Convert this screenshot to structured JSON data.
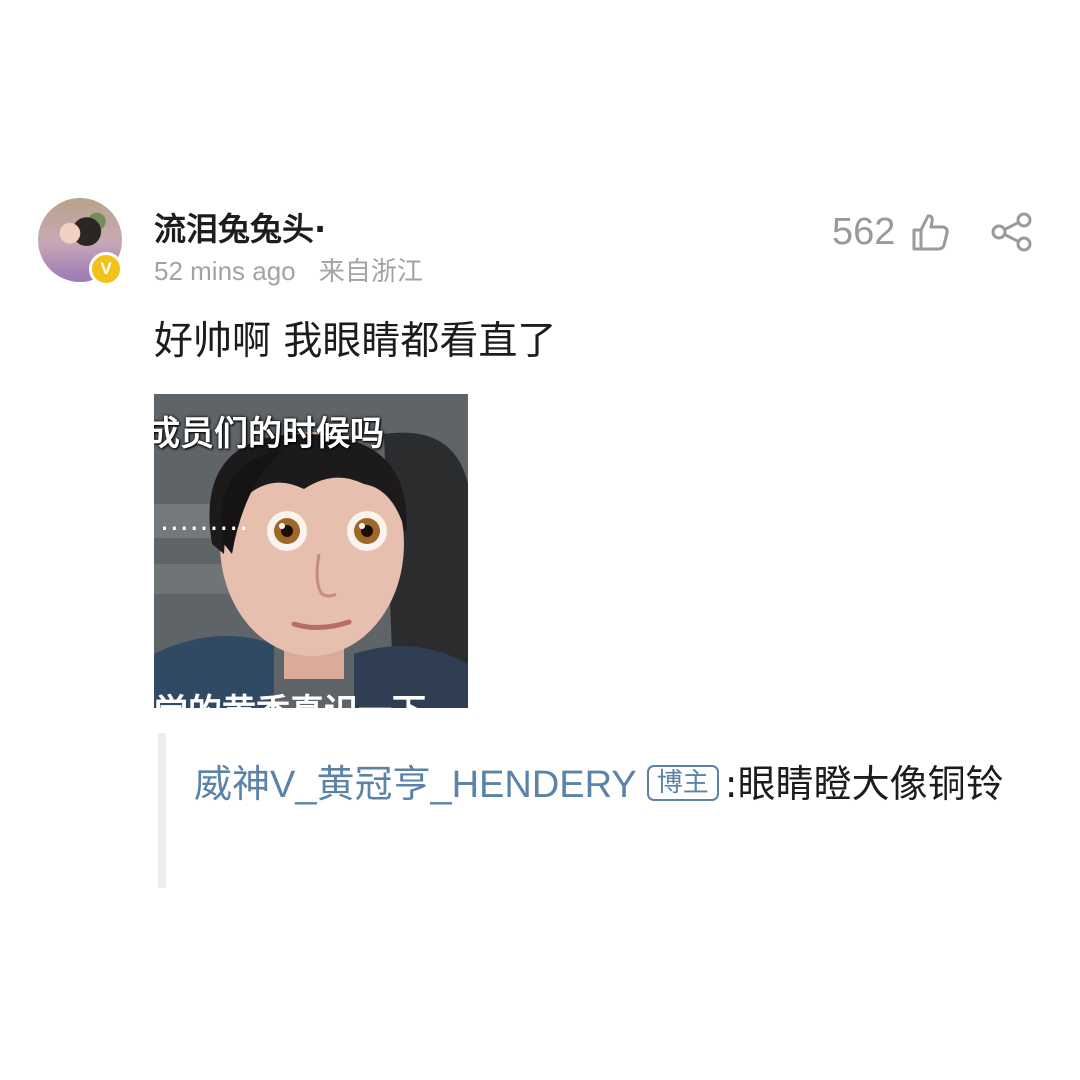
{
  "comment": {
    "username": "流泪兔兔头·",
    "time_ago": "52 mins ago",
    "location": "来自浙江",
    "like_count": "562",
    "text": "好帅啊 我眼睛都看直了",
    "icons": {
      "avatar_badge": "verified-v-icon",
      "like": "thumbs-up-icon",
      "share": "share-icon"
    },
    "badge_letter": "V",
    "image": {
      "top_caption": "成员们的时候吗",
      "dots": "·········",
      "bottom_caption": "觉的黄香真识一下"
    }
  },
  "reply": {
    "author": "威神V_黄冠亨_HENDERY",
    "badge": "博主",
    "separator": ":",
    "text": "眼睛瞪大像铜铃"
  },
  "colors": {
    "link": "#5b82a8",
    "meta": "#a3a3a3",
    "badge_gold": "#f3c21a",
    "quote_bar": "#ededed"
  }
}
